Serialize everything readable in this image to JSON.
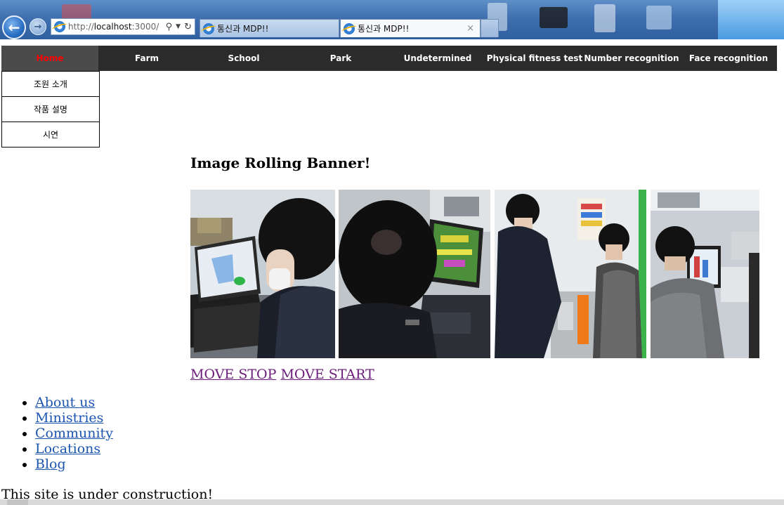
{
  "browser": {
    "address": {
      "prefix": "http://",
      "host": "localhost",
      "suffix": ":3000/"
    },
    "tabs": [
      {
        "title": "통신과 MDP!!"
      },
      {
        "title": "통신과 MDP!!",
        "close": "×"
      }
    ]
  },
  "nav": {
    "items": [
      {
        "label": "Home"
      },
      {
        "label": "Farm"
      },
      {
        "label": "School"
      },
      {
        "label": "Park"
      },
      {
        "label": "Undetermined"
      },
      {
        "label": "Physical fitness test"
      },
      {
        "label": "Number recognition"
      },
      {
        "label": "Face recognition"
      }
    ],
    "active_color": "#ff0000",
    "bar_color": "#2b2b2b"
  },
  "submenu": {
    "items": [
      {
        "label": "조원 소개"
      },
      {
        "label": "작품 설명"
      },
      {
        "label": "시연"
      }
    ]
  },
  "banner": {
    "heading": "Image Rolling Banner!",
    "stop_label": "MOVE STOP",
    "start_label": "MOVE START"
  },
  "links": [
    {
      "label": "About us"
    },
    {
      "label": "Ministries"
    },
    {
      "label": "Community"
    },
    {
      "label": "Locations"
    },
    {
      "label": "Blog"
    }
  ],
  "footer": {
    "note": "This site is under construction!"
  }
}
